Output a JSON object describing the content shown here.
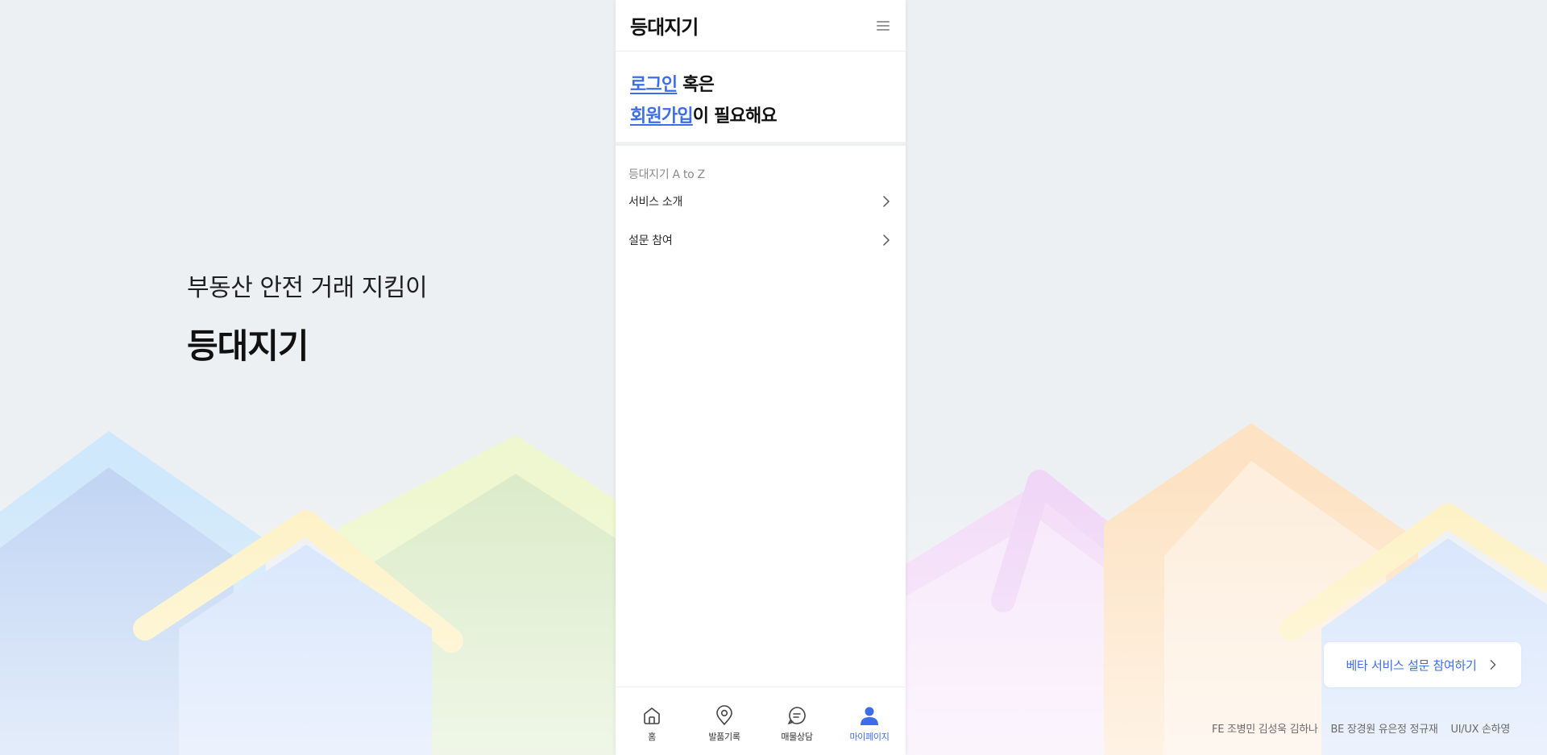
{
  "hero": {
    "subtitle": "부동산 안전 거래 지킴이",
    "title": "등대지기"
  },
  "header": {
    "app_title": "등대지기",
    "menu_icon": "hamburger-menu-icon"
  },
  "login_prompt": {
    "login_link": "로그인",
    "connector": " 혹은",
    "signup_link": "회원가입",
    "suffix": "이 필요해요"
  },
  "section": {
    "label": "등대지기 A to Z",
    "items": [
      {
        "label": "서비스 소개",
        "icon": "chevron-right-icon"
      },
      {
        "label": "설문 참여",
        "icon": "chevron-right-icon"
      }
    ]
  },
  "tabbar": {
    "tabs": [
      {
        "label": "홈",
        "icon": "home-icon",
        "active": false
      },
      {
        "label": "발품기록",
        "icon": "map-pin-icon",
        "active": false
      },
      {
        "label": "매물상담",
        "icon": "chat-bubble-icon",
        "active": false
      },
      {
        "label": "마이페이지",
        "icon": "user-icon",
        "active": true
      }
    ]
  },
  "survey_button": {
    "label": "베타 서비스 설문 참여하기",
    "icon": "chevron-right-icon"
  },
  "credits": [
    "FE 조병민 김성욱 김하나",
    "BE 장경원 유은정 정규재",
    "UI/UX 손하영"
  ],
  "colors": {
    "accent": "#3d6ee8",
    "background": "#edf0f3",
    "divider": "#eef0f2"
  }
}
